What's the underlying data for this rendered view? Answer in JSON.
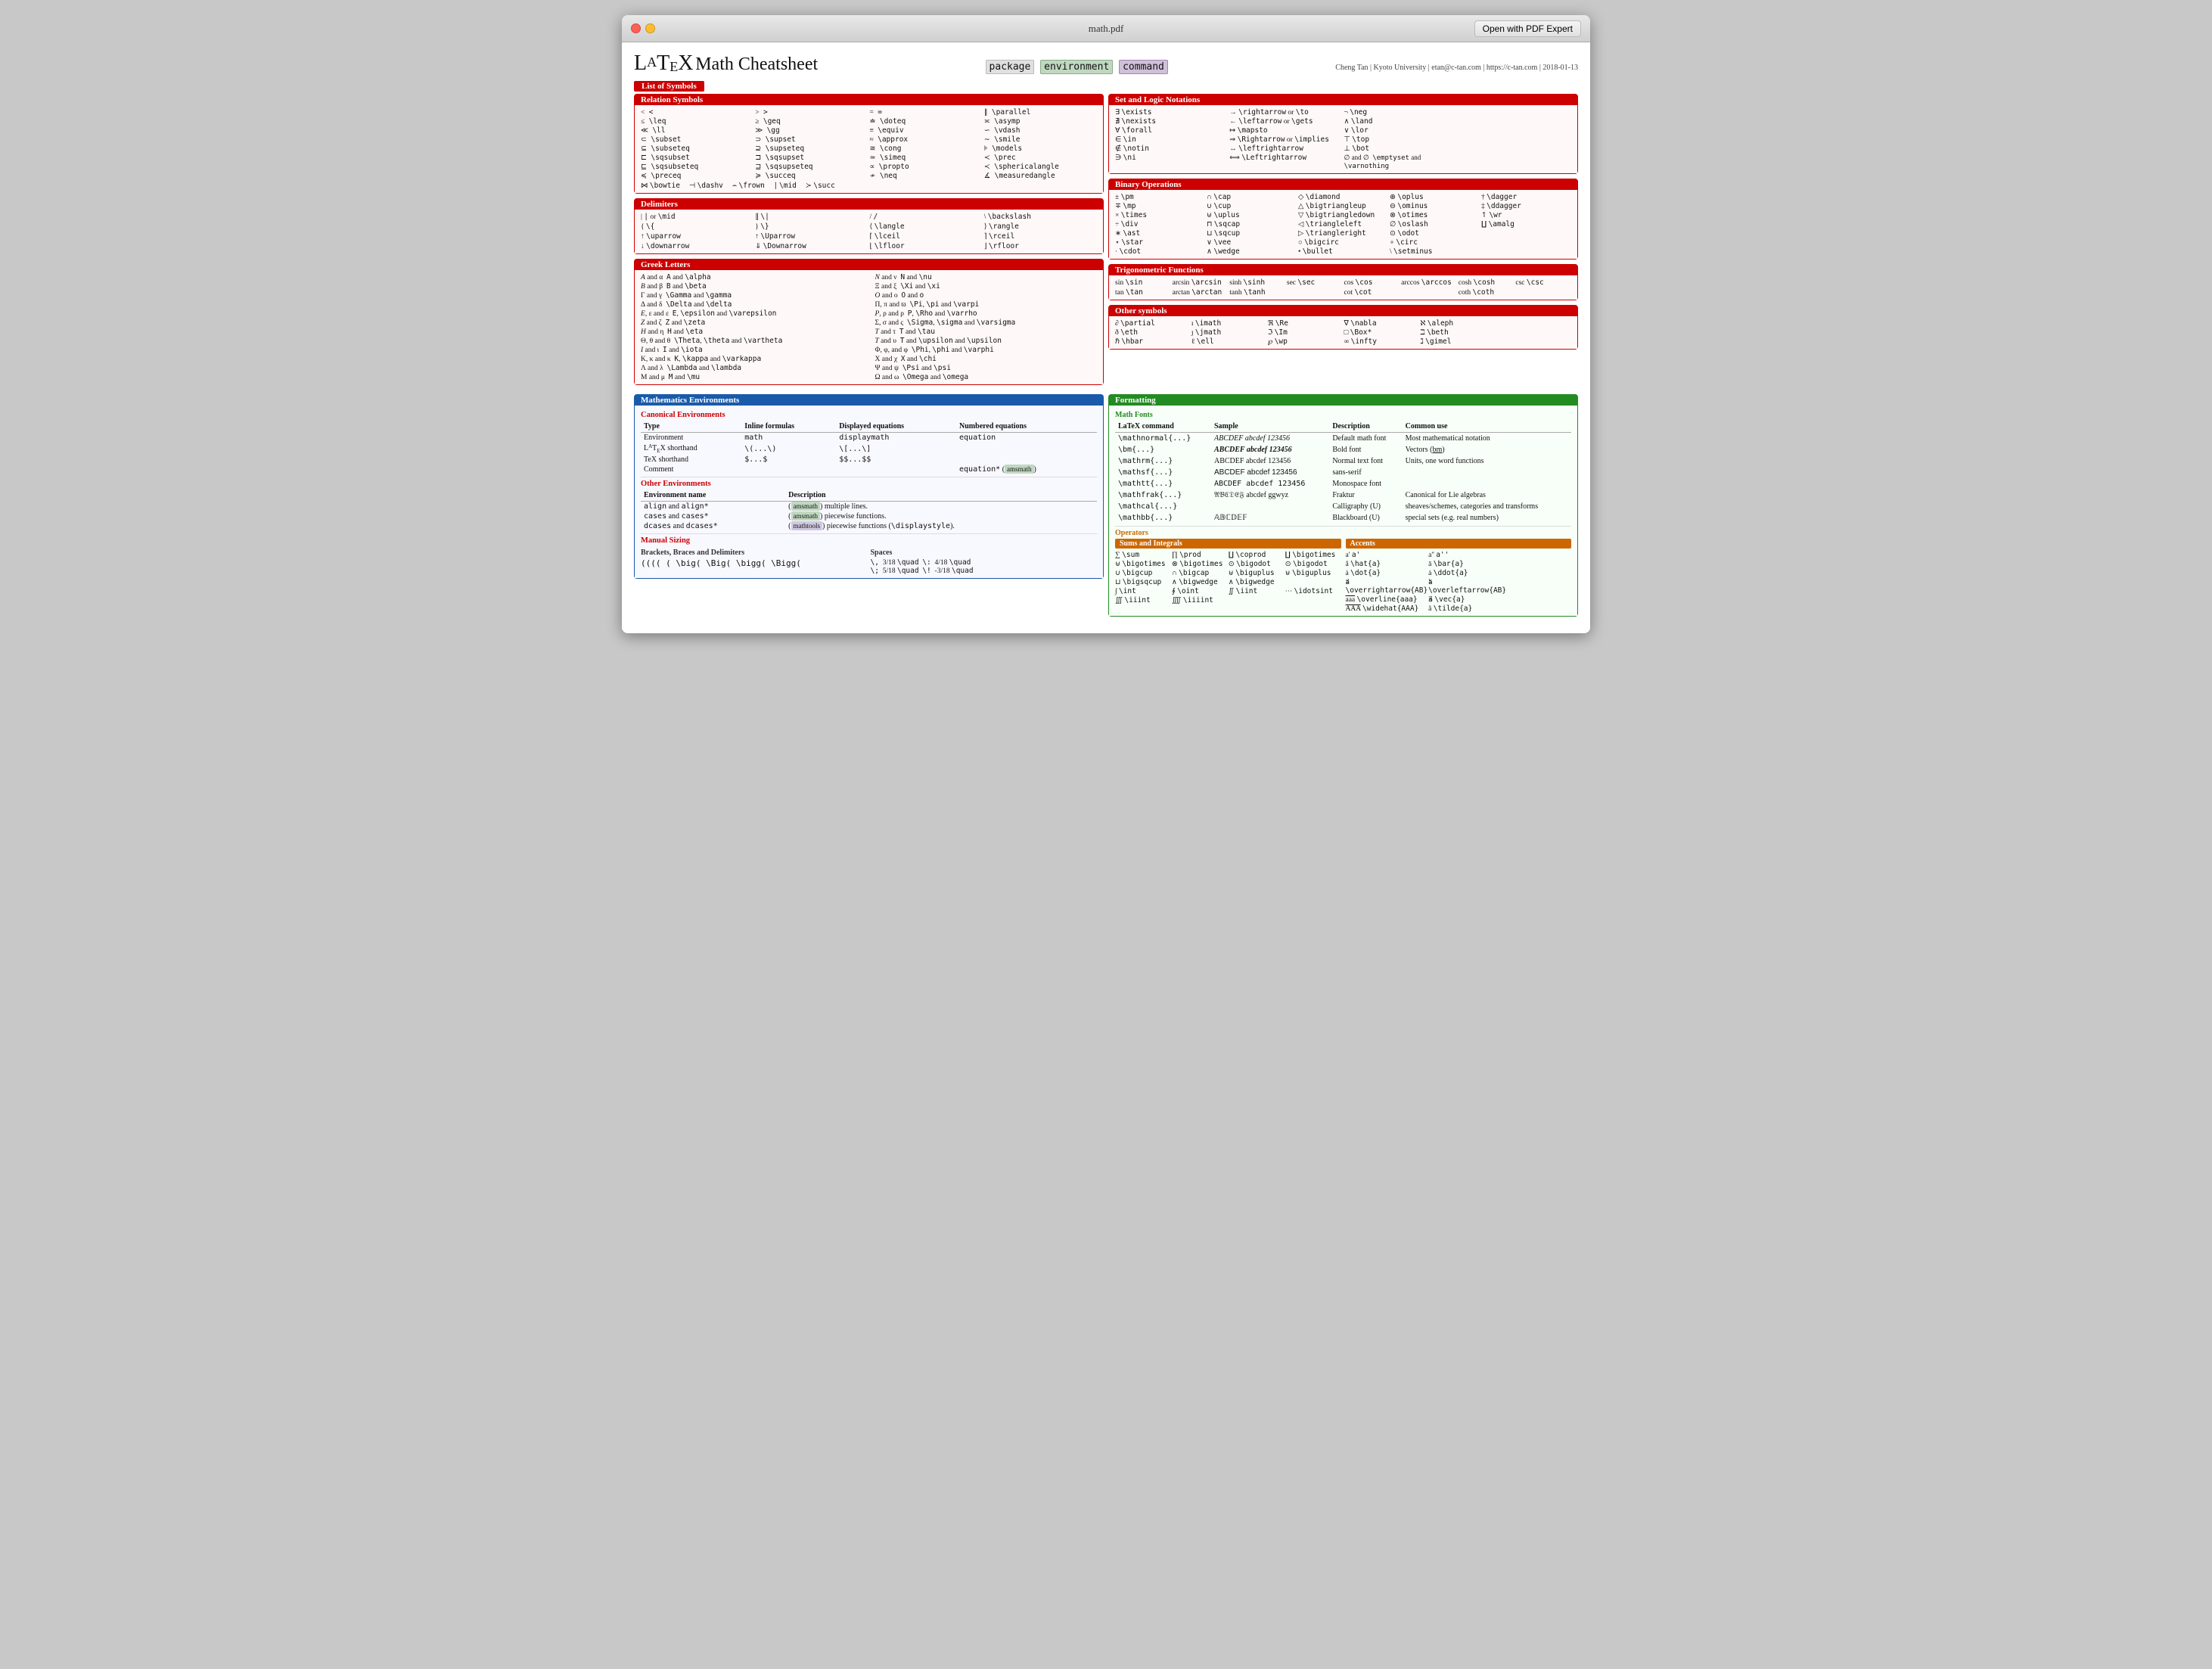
{
  "window": {
    "title": "math.pdf",
    "open_btn": "Open with PDF Expert"
  },
  "doc": {
    "title": "LaTeX Math Cheatsheet",
    "pkg": "package",
    "env": "environment",
    "cmd": "command",
    "info": "Cheng Tan | Kyoto University | etan@c-tan.com | https://c-tan.com | 2018-01-13"
  },
  "sections": {
    "list_of_symbols": "List of Symbols",
    "relation_symbols": "Relation Symbols",
    "set_logic": "Set and Logic Notations",
    "binary_ops": "Binary Operations",
    "delimiters": "Delimiters",
    "greek": "Greek Letters",
    "trig": "Trigonometric Functions",
    "other_symbols": "Other symbols",
    "math_envs": "Mathematics Environments",
    "canonical_envs": "Canonical Environments",
    "other_envs": "Other Environments",
    "manual_sizing": "Manual Sizing",
    "formatting": "Formatting",
    "math_fonts": "Math Fonts",
    "operators": "Operators",
    "sums_integrals": "Sums and Integrals",
    "accents": "Accents"
  }
}
